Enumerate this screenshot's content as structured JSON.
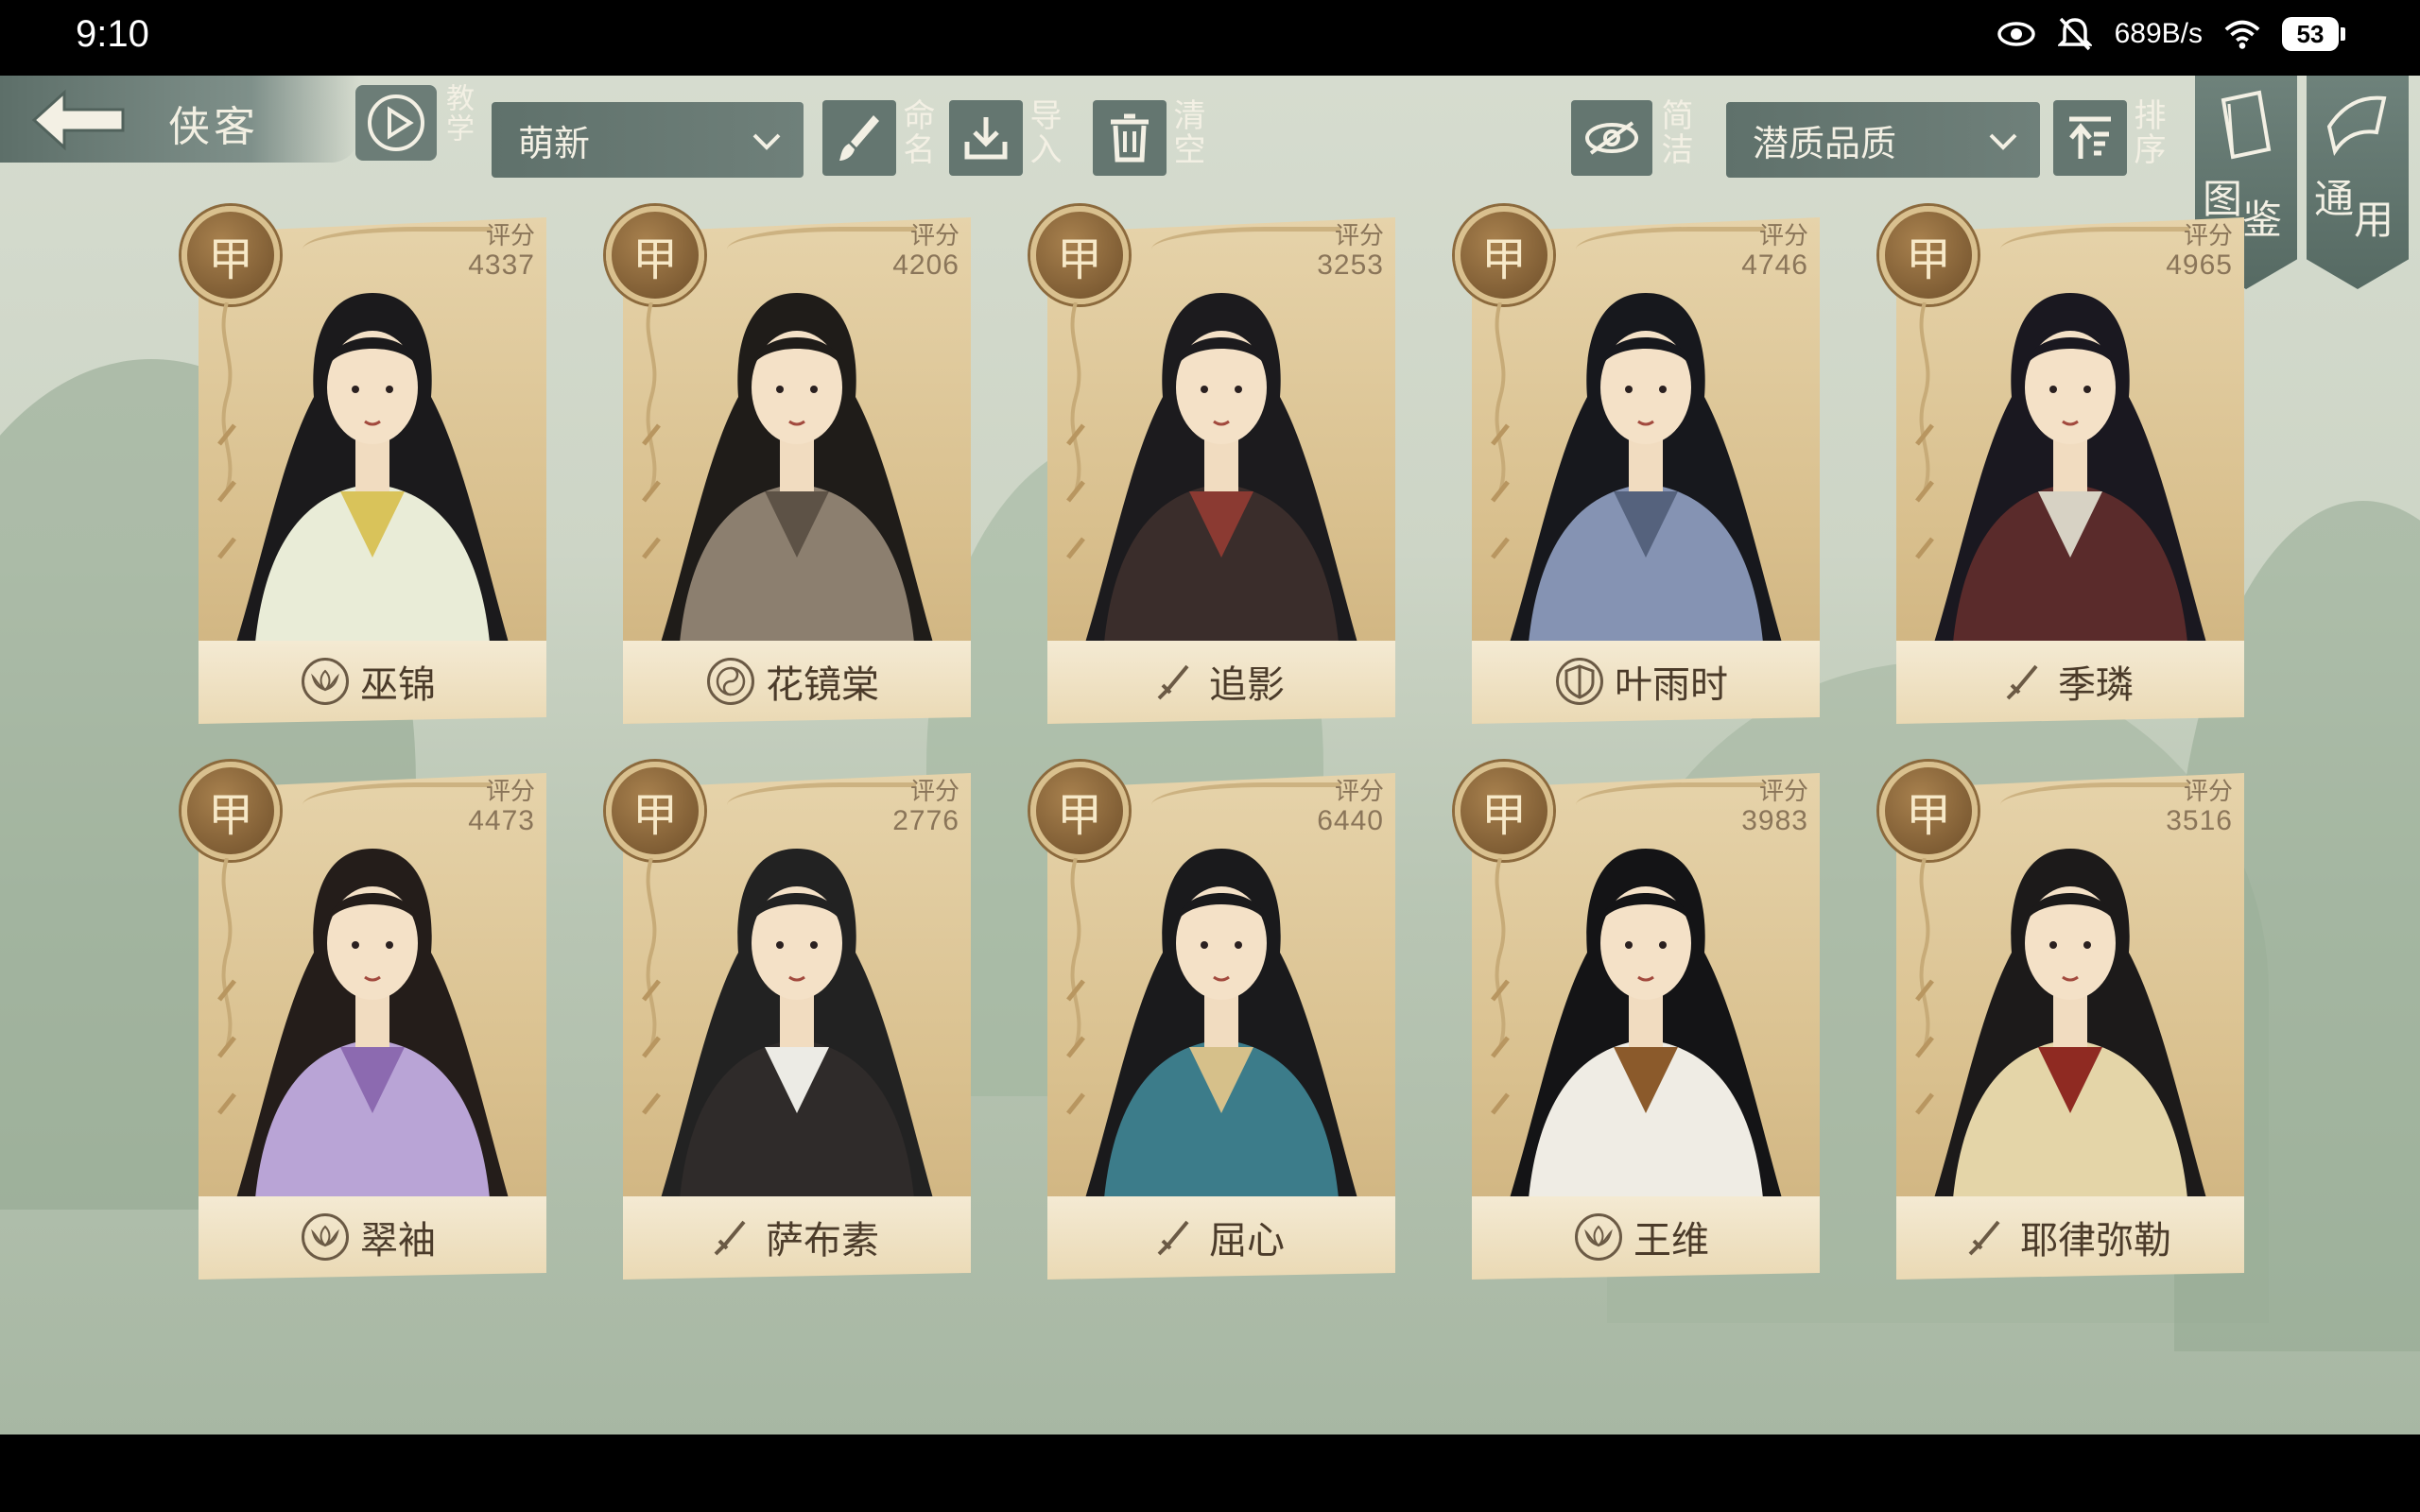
{
  "status_bar": {
    "time": "9:10",
    "net_speed": "689B/s",
    "battery": "53",
    "icons": [
      "eye-icon",
      "mute-icon",
      "wifi-icon",
      "battery-icon"
    ]
  },
  "header": {
    "title": "侠客",
    "tutorial_label": "教学",
    "filter_dropdown": "萌新",
    "rename_label": "命名",
    "import_label": "导入",
    "clear_label": "清空",
    "simple_label": "简洁",
    "sort_dropdown": "潜质品质",
    "sort_label": "排序",
    "codex_label": "图鉴",
    "general_label": "通用"
  },
  "score_label": "评分",
  "colors": {
    "accent_teal": "#6c7d77",
    "card_gold": "#d9c08e",
    "badge_brown": "#7a5a33"
  },
  "cards": [
    {
      "name": "巫锦",
      "rank": "甲",
      "score": "4337",
      "class_icon": "lotus-icon"
    },
    {
      "name": "花镜棠",
      "rank": "甲",
      "score": "4206",
      "class_icon": "taiji-icon"
    },
    {
      "name": "追影",
      "rank": "甲",
      "score": "3253",
      "class_icon": "sword-icon"
    },
    {
      "name": "叶雨时",
      "rank": "甲",
      "score": "4746",
      "class_icon": "shield-icon"
    },
    {
      "name": "季璘",
      "rank": "甲",
      "score": "4965",
      "class_icon": "sword-icon"
    },
    {
      "name": "翠袖",
      "rank": "甲",
      "score": "4473",
      "class_icon": "lotus-icon"
    },
    {
      "name": "萨布素",
      "rank": "甲",
      "score": "2776",
      "class_icon": "sword-icon"
    },
    {
      "name": "屈心",
      "rank": "甲",
      "score": "6440",
      "class_icon": "sword-icon"
    },
    {
      "name": "王维",
      "rank": "甲",
      "score": "3983",
      "class_icon": "lotus-icon"
    },
    {
      "name": "耶律弥勒",
      "rank": "甲",
      "score": "3516",
      "class_icon": "sword-icon"
    }
  ],
  "partial_row": [
    {
      "label": "评分",
      "badge": "gold"
    },
    {
      "label": "评分",
      "badge": "gold"
    },
    {
      "label": "评分",
      "badge": "blue"
    },
    {
      "label": "评分",
      "badge": "blue"
    },
    {
      "label": "评分",
      "badge": "blue"
    }
  ]
}
